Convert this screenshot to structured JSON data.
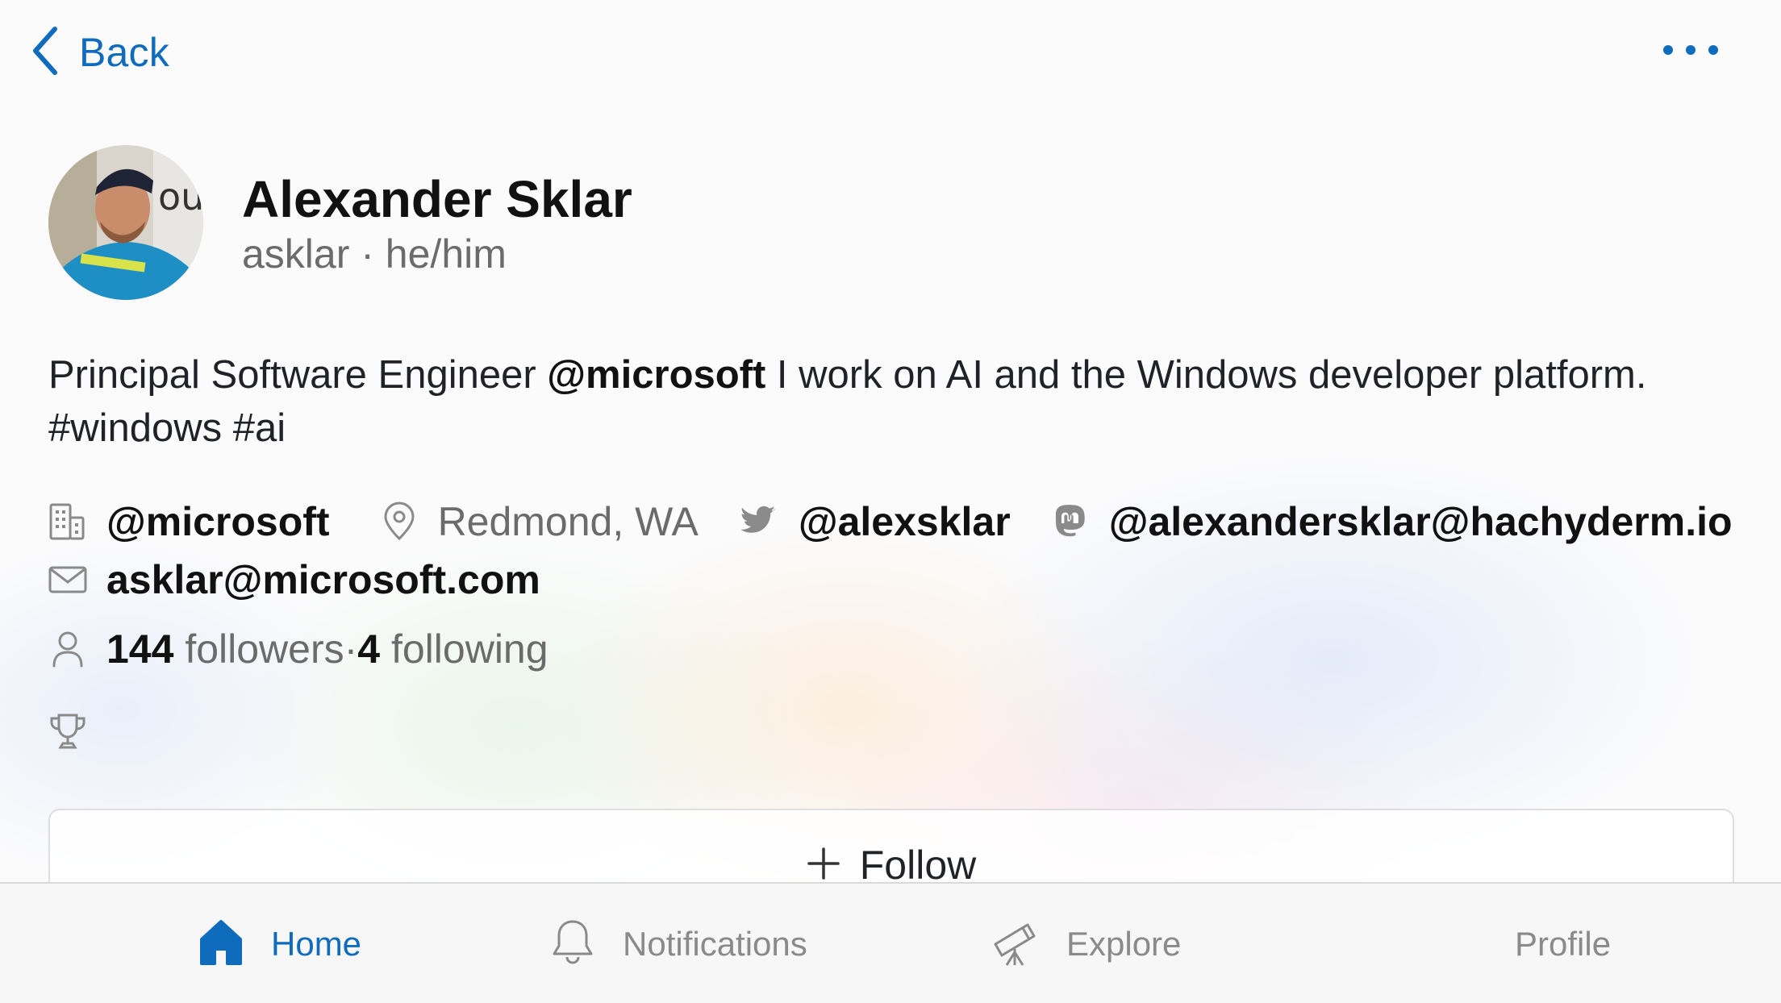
{
  "nav": {
    "back_label": "Back",
    "more_icon": "more-horizontal-icon"
  },
  "profile": {
    "name": "Alexander Sklar",
    "handle_line": "asklar · he/him",
    "bio": {
      "prefix": "Principal Software Engineer ",
      "mention": "@microsoft",
      "suffix": "  I work on AI and the Windows developer platform.",
      "hashtags": "#windows #ai"
    },
    "company": "@microsoft",
    "location": "Redmond, WA",
    "twitter": "@alexsklar",
    "mastodon": "@alexandersklar@hachyderm.io",
    "email": "asklar@microsoft.com",
    "followers_count": "144",
    "followers_label": " followers",
    "separator": " · ",
    "following_count": "4",
    "following_label": " following"
  },
  "follow_button": {
    "label": "Follow"
  },
  "tabs": [
    {
      "label": "Home",
      "icon": "home-icon",
      "active": true
    },
    {
      "label": "Notifications",
      "icon": "bell-icon",
      "active": false
    },
    {
      "label": "Explore",
      "icon": "telescope-icon",
      "active": false
    },
    {
      "label": "Profile",
      "icon": "",
      "active": false
    }
  ],
  "colors": {
    "accent": "#0f6cbd",
    "muted_text": "#6b6b6b",
    "icon_gray": "#8a8a8a"
  }
}
